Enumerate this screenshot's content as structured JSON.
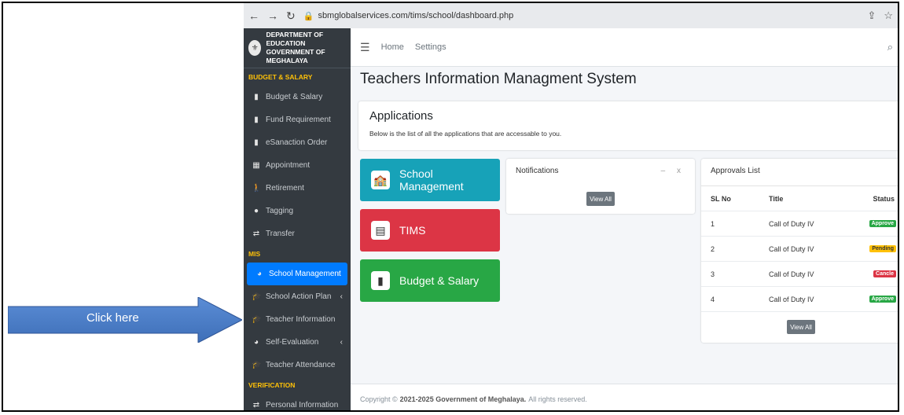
{
  "browser": {
    "url": "sbmglobalservices.com/tims/school/dashboard.php"
  },
  "brand": {
    "line1": "DEPARTMENT OF EDUCATION",
    "line2": "GOVERNMENT OF MEGHALAYA"
  },
  "sidebar": {
    "sections": {
      "budget": "BUDGET & SALARY",
      "mis": "MIS",
      "verification": "VERIFICATION"
    },
    "items": [
      {
        "label": "Budget & Salary",
        "icon": "briefcase-icon"
      },
      {
        "label": "Fund Requirement",
        "icon": "briefcase-icon"
      },
      {
        "label": "eSanaction Order",
        "icon": "briefcase-icon"
      },
      {
        "label": "Appointment",
        "icon": "calendar-icon"
      },
      {
        "label": "Retirement",
        "icon": "walking-icon"
      },
      {
        "label": "Tagging",
        "icon": "globe-icon"
      },
      {
        "label": "Transfer",
        "icon": "exchange-icon"
      },
      {
        "label": "School Management",
        "icon": "pie-chart-icon"
      },
      {
        "label": "School Action Plan",
        "icon": "graduation-cap-icon"
      },
      {
        "label": "Teacher Information",
        "icon": "graduation-cap-icon"
      },
      {
        "label": "Self-Evaluation",
        "icon": "pie-chart-icon"
      },
      {
        "label": "Teacher Attendance",
        "icon": "graduation-cap-icon"
      },
      {
        "label": "Personal Information",
        "icon": "exchange-icon"
      }
    ]
  },
  "topnav": {
    "home": "Home",
    "settings": "Settings"
  },
  "page": {
    "title": "Teachers Information Managment System"
  },
  "applications": {
    "title": "Applications",
    "subtitle": "Below is the list of all the applications that are accessable to you."
  },
  "tiles": [
    {
      "label": "School Management",
      "color": "#17a2b8"
    },
    {
      "label": "TIMS",
      "color": "#dc3545"
    },
    {
      "label": "Budget & Salary",
      "color": "#28a745"
    }
  ],
  "notifications": {
    "title": "Notifications",
    "controls": "– x",
    "view_all": "View All"
  },
  "approvals": {
    "title": "Approvals List",
    "headers": {
      "sl": "SL No",
      "title": "Title",
      "status": "Status"
    },
    "rows": [
      {
        "sl": "1",
        "title": "Call of Duty IV",
        "status": "Approve",
        "color": "#28a745"
      },
      {
        "sl": "2",
        "title": "Call of Duty IV",
        "status": "Pending",
        "color": "#ffc107"
      },
      {
        "sl": "3",
        "title": "Call of Duty IV",
        "status": "Cancle",
        "color": "#dc3545"
      },
      {
        "sl": "4",
        "title": "Call of Duty IV",
        "status": "Approve",
        "color": "#28a745"
      }
    ],
    "view_all": "View All"
  },
  "footer": {
    "prefix": "Copyright ©",
    "org": "2021-2025 Government of Meghalaya.",
    "suffix": "All rights reserved."
  },
  "callout": {
    "text": "Click here"
  }
}
